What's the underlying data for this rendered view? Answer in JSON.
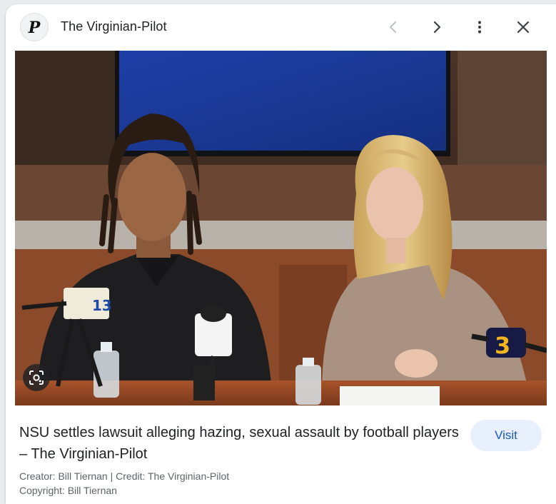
{
  "header": {
    "publisher_name": "The Virginian-Pilot",
    "logo_glyph": "P",
    "icons": {
      "prev": "chevron-left-icon",
      "next": "chevron-right-icon",
      "more": "more-vert-icon",
      "close": "close-icon"
    }
  },
  "image": {
    "mic_label_left": "13",
    "mic_label_right": "3"
  },
  "result": {
    "title": "NSU settles lawsuit alleging hazing, sexual assault by football players – The Virginian-Pilot",
    "visit_label": "Visit",
    "creator_credit": "Creator: Bill Tiernan | Credit: The Virginian-Pilot",
    "copyright": "Copyright: Bill Tiernan"
  },
  "colors": {
    "accent": "#1a57c2",
    "visit_bg": "#e8f0fe",
    "text": "#202124",
    "muted": "#5f6368"
  }
}
